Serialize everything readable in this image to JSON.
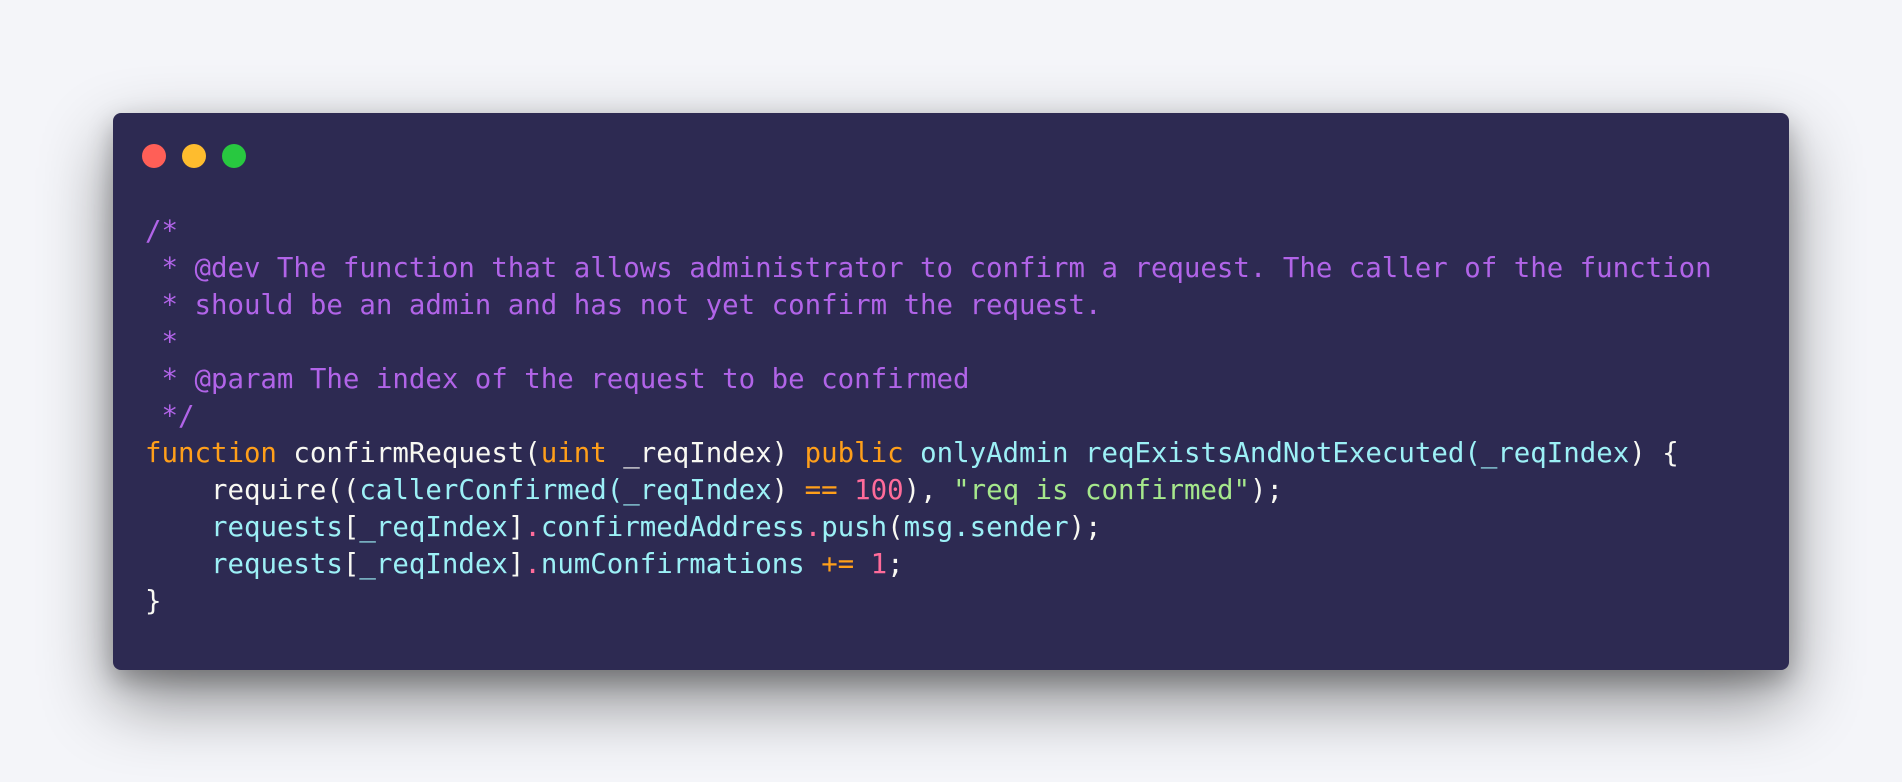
{
  "window": {
    "controls": [
      {
        "name": "close",
        "color": "#ff5f57"
      },
      {
        "name": "minimize",
        "color": "#febc2e"
      },
      {
        "name": "zoom",
        "color": "#28c840"
      }
    ]
  },
  "colors": {
    "background": "#2d2a52",
    "comment": "#b164e8",
    "keyword": "#ff9f1a",
    "type": "#ff9f1a",
    "plain": "#f8f8f2",
    "call": "#9cf0f6",
    "number": "#ff6b9a",
    "string": "#a6e88c",
    "operator": "#ff9f1a",
    "punct": "#f8f8f2",
    "dot": "#ff6b9a"
  },
  "code": {
    "language": "Solidity",
    "lines": [
      [
        {
          "t": "/*",
          "k": "comment"
        }
      ],
      [
        {
          "t": " * @dev The function that allows administrator to confirm a request. The caller of the function",
          "k": "comment"
        }
      ],
      [
        {
          "t": " * should be an admin and has not yet confirm the request.",
          "k": "comment"
        }
      ],
      [
        {
          "t": " *",
          "k": "comment"
        }
      ],
      [
        {
          "t": " * @param The index of the request to be confirmed",
          "k": "comment"
        }
      ],
      [
        {
          "t": " */",
          "k": "comment"
        }
      ],
      [
        {
          "t": "function",
          "k": "keyword"
        },
        {
          "t": " confirmRequest(",
          "k": "plain"
        },
        {
          "t": "uint",
          "k": "type"
        },
        {
          "t": " _reqIndex) ",
          "k": "plain"
        },
        {
          "t": "public",
          "k": "keyword"
        },
        {
          "t": " ",
          "k": "plain"
        },
        {
          "t": "onlyAdmin",
          "k": "call"
        },
        {
          "t": " ",
          "k": "plain"
        },
        {
          "t": "reqExistsAndNotExecuted",
          "k": "call"
        },
        {
          "t": "(",
          "k": "call"
        },
        {
          "t": "_reqIndex",
          "k": "call"
        },
        {
          "t": ") {",
          "k": "plain"
        }
      ],
      [
        {
          "t": "    require((",
          "k": "plain"
        },
        {
          "t": "callerConfirmed",
          "k": "call"
        },
        {
          "t": "(",
          "k": "call"
        },
        {
          "t": "_reqIndex",
          "k": "call"
        },
        {
          "t": ") ",
          "k": "plain"
        },
        {
          "t": "==",
          "k": "operator"
        },
        {
          "t": " ",
          "k": "plain"
        },
        {
          "t": "100",
          "k": "number"
        },
        {
          "t": "), ",
          "k": "plain"
        },
        {
          "t": "\"req is confirmed\"",
          "k": "string"
        },
        {
          "t": ");",
          "k": "plain"
        }
      ],
      [
        {
          "t": "    ",
          "k": "plain"
        },
        {
          "t": "requests",
          "k": "call"
        },
        {
          "t": "[",
          "k": "plain"
        },
        {
          "t": "_reqIndex",
          "k": "call"
        },
        {
          "t": "]",
          "k": "plain"
        },
        {
          "t": ".",
          "k": "dot"
        },
        {
          "t": "confirmedAddress",
          "k": "call"
        },
        {
          "t": ".",
          "k": "dot"
        },
        {
          "t": "push",
          "k": "call"
        },
        {
          "t": "(",
          "k": "plain"
        },
        {
          "t": "msg.sender",
          "k": "call"
        },
        {
          "t": ");",
          "k": "plain"
        }
      ],
      [
        {
          "t": "    ",
          "k": "plain"
        },
        {
          "t": "requests",
          "k": "call"
        },
        {
          "t": "[",
          "k": "plain"
        },
        {
          "t": "_reqIndex",
          "k": "call"
        },
        {
          "t": "]",
          "k": "plain"
        },
        {
          "t": ".",
          "k": "dot"
        },
        {
          "t": "numConfirmations",
          "k": "call"
        },
        {
          "t": " ",
          "k": "plain"
        },
        {
          "t": "+=",
          "k": "operator"
        },
        {
          "t": " ",
          "k": "plain"
        },
        {
          "t": "1",
          "k": "number"
        },
        {
          "t": ";",
          "k": "plain"
        }
      ],
      [
        {
          "t": "}",
          "k": "plain"
        }
      ]
    ]
  }
}
